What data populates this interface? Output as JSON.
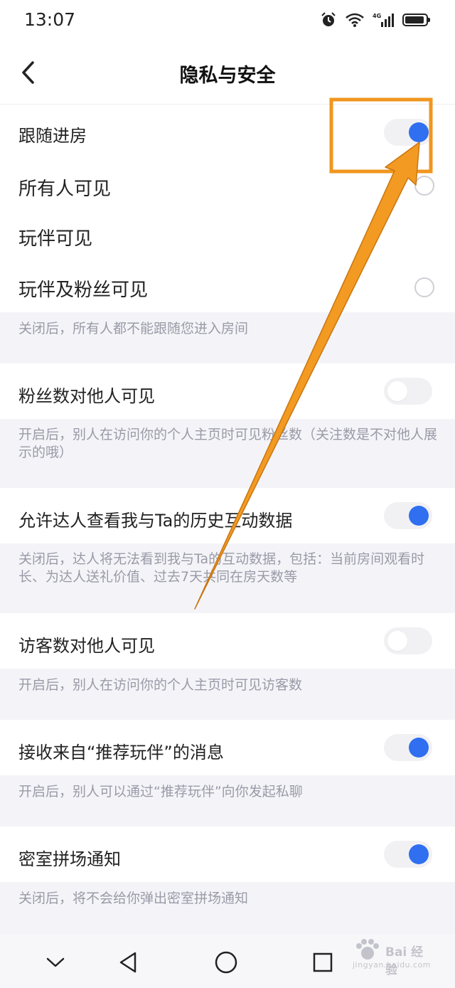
{
  "status_bar": {
    "time": "13:07",
    "network": "4G"
  },
  "header": {
    "title": "隐私与安全"
  },
  "follow_room": {
    "label": "跟随进房",
    "enabled": true,
    "options": [
      "所有人可见",
      "玩伴可见",
      "玩伴及粉丝可见"
    ],
    "description": "关闭后，所有人都不能跟随您进入房间"
  },
  "fans_visible": {
    "label": "粉丝数对他人可见",
    "enabled": false,
    "description": "开启后，别人在访问你的个人主页时可见粉丝数（关注数是不对他人展示的哦）"
  },
  "talent_history": {
    "label": "允许达人查看我与Ta的历史互动数据",
    "enabled": true,
    "description": "关闭后，达人将无法看到我与Ta的互动数据，包括：当前房间观看时长、为达人送礼价值、过去7天共同在房天数等"
  },
  "visitors_visible": {
    "label": "访客数对他人可见",
    "enabled": false,
    "description": "开启后，别人在访问你的个人主页时可见访客数"
  },
  "recommend_msg": {
    "label": "接收来自“推荐玩伴”的消息",
    "enabled": true,
    "description": "开启后，别人可以通过“推荐玩伴”向你发起私聊"
  },
  "escape_room": {
    "label": "密室拼场通知",
    "enabled": true,
    "description": "关闭后，将不会给你弹出密室拼场通知"
  },
  "watermark": {
    "brand": "Bai 经验",
    "sub": "jingyan.baidu.com"
  },
  "colors": {
    "accent": "#2f6ff0",
    "annotation": "#f0961e",
    "background": "#f4f4f8"
  }
}
